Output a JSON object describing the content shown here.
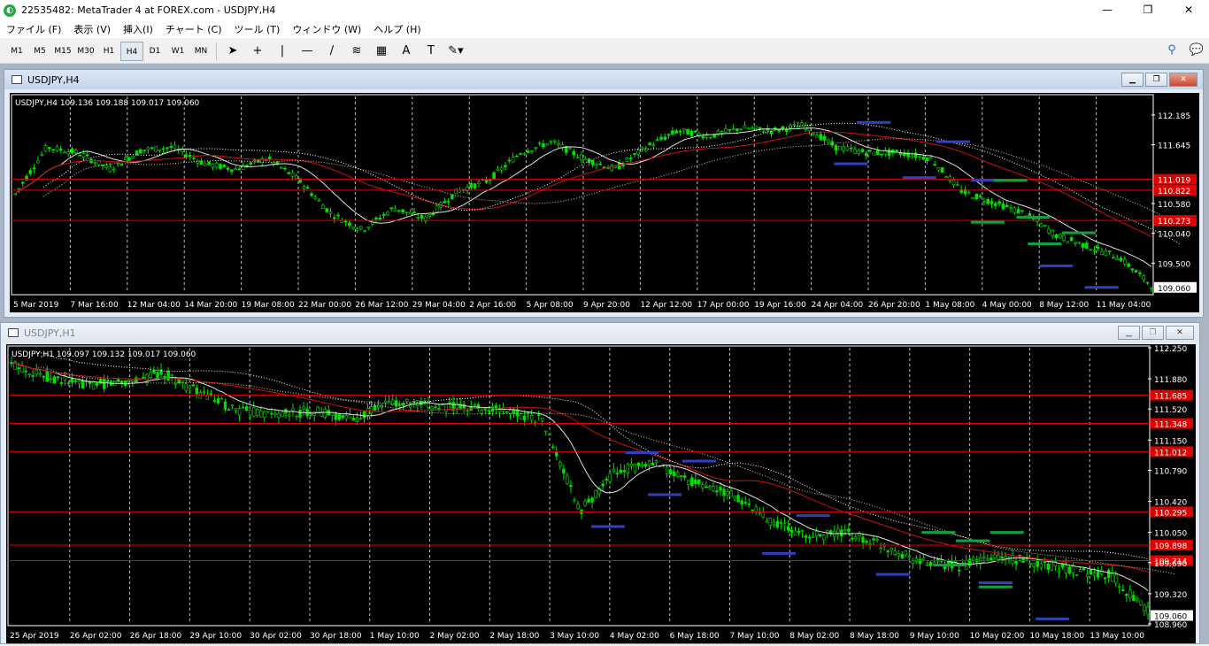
{
  "window": {
    "title": "22535482: MetaTrader 4 at FOREX.com - USDJPY,H4",
    "minimize": "—",
    "maximize": "❐",
    "close": "✕"
  },
  "menu": [
    "ファイル (F)",
    "表示 (V)",
    "挿入(I)",
    "チャート (C)",
    "ツール (T)",
    "ウィンドウ (W)",
    "ヘルプ (H)"
  ],
  "toolbar": {
    "timeframes": [
      "M1",
      "M5",
      "M15",
      "M30",
      "H1",
      "H4",
      "D1",
      "W1",
      "MN"
    ],
    "active_timeframe": "H4",
    "tools": [
      "cursor-icon",
      "crosshair-icon",
      "vertical-line-icon",
      "horizontal-line-icon",
      "trendline-icon",
      "fibonacci-icon",
      "channel-icon",
      "text-icon",
      "label-icon",
      "shapes-icon"
    ],
    "tool_glyphs": [
      "➤",
      "+",
      "|",
      "—",
      "/",
      "≋",
      "▦",
      "A",
      "T",
      "✎▾"
    ],
    "right_icons": [
      "search-icon",
      "chat-icon"
    ]
  },
  "charts": [
    {
      "window_title": "USDJPY,H4",
      "info": "USDJPY,H4  109.136 109.188 109.017 109.060",
      "price_axis": [
        {
          "v": 112.185,
          "label": "112.185"
        },
        {
          "v": 111.645,
          "label": "111.645"
        },
        {
          "v": 110.58,
          "label": "110.580"
        },
        {
          "v": 110.04,
          "label": "110.040"
        },
        {
          "v": 109.5,
          "label": "109.500"
        }
      ],
      "levels": [
        {
          "v": 111.019,
          "label": "111.019"
        },
        {
          "v": 110.822,
          "label": "110.822"
        },
        {
          "v": 110.273,
          "label": "110.273"
        }
      ],
      "current": {
        "v": 109.06,
        "label": "109.060"
      },
      "range": [
        108.96,
        112.52
      ],
      "time_axis": [
        "5 Mar 2019",
        "7 Mar 16:00",
        "12 Mar 04:00",
        "14 Mar 20:00",
        "19 Mar 08:00",
        "22 Mar 00:00",
        "26 Mar 12:00",
        "29 Mar 04:00",
        "2 Apr 16:00",
        "5 Apr 08:00",
        "9 Apr 20:00",
        "12 Apr 12:00",
        "17 Apr 00:00",
        "19 Apr 16:00",
        "24 Apr 04:00",
        "26 Apr 20:00",
        "1 May 08:00",
        "4 May 00:00",
        "8 May 12:00",
        "11 May 04:00"
      ]
    },
    {
      "window_title": "USDJPY,H1",
      "info": "USDJPY,H1  109.097 109.132 109.017 109.060",
      "price_axis": [
        {
          "v": 112.25,
          "label": "112.250"
        },
        {
          "v": 111.88,
          "label": "111.880"
        },
        {
          "v": 111.52,
          "label": "111.520"
        },
        {
          "v": 111.15,
          "label": "111.150"
        },
        {
          "v": 110.79,
          "label": "110.790"
        },
        {
          "v": 110.42,
          "label": "110.420"
        },
        {
          "v": 110.05,
          "label": "110.050"
        },
        {
          "v": 109.69,
          "label": "109.690"
        },
        {
          "v": 109.32,
          "label": "109.320"
        },
        {
          "v": 108.96,
          "label": "108.960"
        }
      ],
      "levels": [
        {
          "v": 111.685,
          "label": "111.685"
        },
        {
          "v": 111.348,
          "label": "111.348"
        },
        {
          "v": 111.012,
          "label": "111.012"
        },
        {
          "v": 110.295,
          "label": "110.295"
        },
        {
          "v": 109.898,
          "label": "109.898"
        },
        {
          "v": 109.714,
          "label": "109.714"
        }
      ],
      "current": {
        "v": 109.06,
        "label": "109.060"
      },
      "range": [
        108.96,
        112.25
      ],
      "time_axis": [
        "25 Apr 2019",
        "26 Apr 02:00",
        "26 Apr 18:00",
        "29 Apr 10:00",
        "30 Apr 02:00",
        "30 Apr 18:00",
        "1 May 10:00",
        "2 May 02:00",
        "2 May 18:00",
        "3 May 10:00",
        "4 May 02:00",
        "6 May 18:00",
        "7 May 10:00",
        "8 May 02:00",
        "8 May 18:00",
        "9 May 10:00",
        "10 May 02:00",
        "10 May 18:00",
        "13 May 10:00"
      ]
    }
  ],
  "colors": {
    "candle": "#00e000",
    "ma_fast": "#e0e0e0",
    "ma_slow": "#d01010",
    "level_line": "#e00000",
    "level_label_bg": "#e00000",
    "current_bg": "#ffffff",
    "zone_blue": "#3040c0",
    "zone_green": "#10a040",
    "grid": "#c0c0c0"
  }
}
